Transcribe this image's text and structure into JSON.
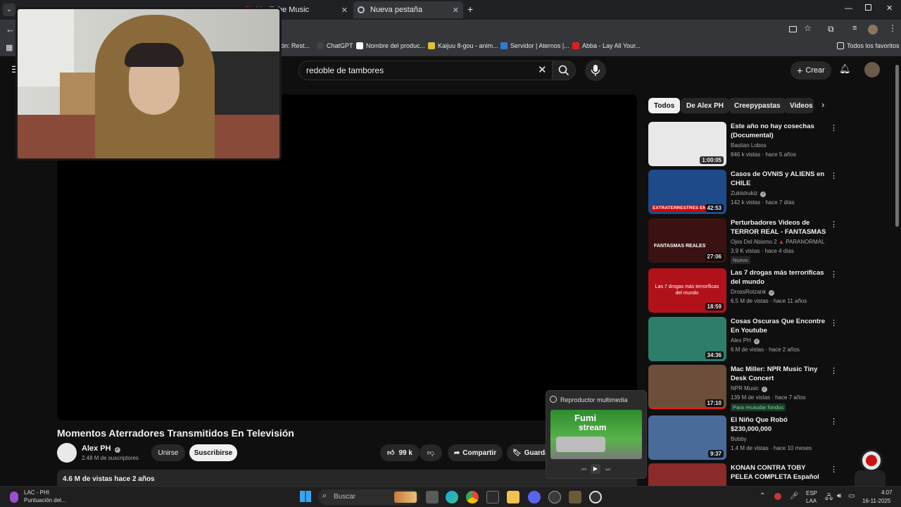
{
  "browser": {
    "tabs": [
      {
        "label": "YouTube Music"
      },
      {
        "label": "Nueva pestaña"
      }
    ],
    "bookmarks": [
      {
        "label": "ón: Rest..."
      },
      {
        "label": "ChatGPT"
      },
      {
        "label": "Nombre del produc..."
      },
      {
        "label": "Kaijuu 8-gou - anim..."
      },
      {
        "label": "Servidor | Aternos |..."
      },
      {
        "label": "Abba - Lay All Your..."
      }
    ],
    "all_favorites": "Todos los favoritos"
  },
  "header": {
    "search_query": "redoble de tambores",
    "create_label": "Crear"
  },
  "video": {
    "title": "Momentos Aterradores Transmitidos En Televisión",
    "channel_name": "Alex PH",
    "subscribers": "2.48 M de suscriptores",
    "join_label": "Unirse",
    "subscribe_label": "Suscribirse",
    "likes": "99 k",
    "share_label": "Compartir",
    "save_label": "Guarda",
    "views_date": "4.6 M de vistas  hace 2 años"
  },
  "chips": [
    "Todos",
    "De Alex PH",
    "Creepypastas",
    "Videos"
  ],
  "recommendations": [
    {
      "title": "Este año no hay cosechas (Documental)",
      "channel": "Bastian Lobos",
      "meta": "846 k vistas · hace 5 años",
      "duration": "1:00:05",
      "thumb_color": "#e8e8e8"
    },
    {
      "title": "Casos de OVNIS y ALIENS en CHILE",
      "channel": "Zukistrukiz",
      "meta": "142 k vistas · hace 7 días",
      "duration": "42:53",
      "thumb_color": "#1e4a8a",
      "thumb_text": "EXTRATERRESTRES EN"
    },
    {
      "title": "Perturbadores Videos de TERROR REAL - FANTASMAS ...",
      "channel": "Ojos Del Abismo 2",
      "channel_extra": "PARANORMAL",
      "meta": "3.9 K vistas · hace 4 días",
      "badge": "Nuevo",
      "duration": "27:06",
      "thumb_color": "#3a1212",
      "thumb_text": "FANTASMAS REALES"
    },
    {
      "title": "Las 7 drogas más terroríficas del mundo",
      "channel": "DrossRotzank",
      "meta": "6.5 M de vistas · hace 11 años",
      "duration": "18:59",
      "thumb_color": "#b1121a",
      "thumb_text": "Las 7 drogas más terroríficas del mundo"
    },
    {
      "title": "Cosas Oscuras Que Encontre En Youtube",
      "channel": "Alex PH",
      "meta": "6 M de vistas · hace 2 años",
      "duration": "34:36",
      "thumb_color": "#2e7d6b"
    },
    {
      "title": "Mac Miller: NPR Music Tiny Desk Concert",
      "channel": "NPR Music",
      "meta": "139 M de vistas · hace 7 años",
      "badge_green": "Para recaudar fondos",
      "duration": "17:10",
      "thumb_color": "#6b4f3a"
    },
    {
      "title": "El Niño Que Robó $230,000,000",
      "channel": "Bobby",
      "meta": "1.4 M de vistas · hace 10 meses",
      "duration": "9:37",
      "thumb_color": "#4a6a9a"
    },
    {
      "title": "KONAN CONTRA TOBY PELEA COMPLETA Español Latino ...",
      "channel": "",
      "meta": "",
      "duration": "",
      "thumb_color": "#8a2a2a"
    }
  ],
  "media_player": {
    "title": "Reproductor multimedia",
    "thumb_text_1": "Fumi",
    "thumb_text_2": "stream"
  },
  "taskbar": {
    "left_title": "LAC - PHI",
    "left_sub": "Puntuación del...",
    "search_placeholder": "Buscar",
    "lang_1": "ESP",
    "lang_2": "LAA",
    "time": "4:07",
    "date": "16-11-2025"
  }
}
